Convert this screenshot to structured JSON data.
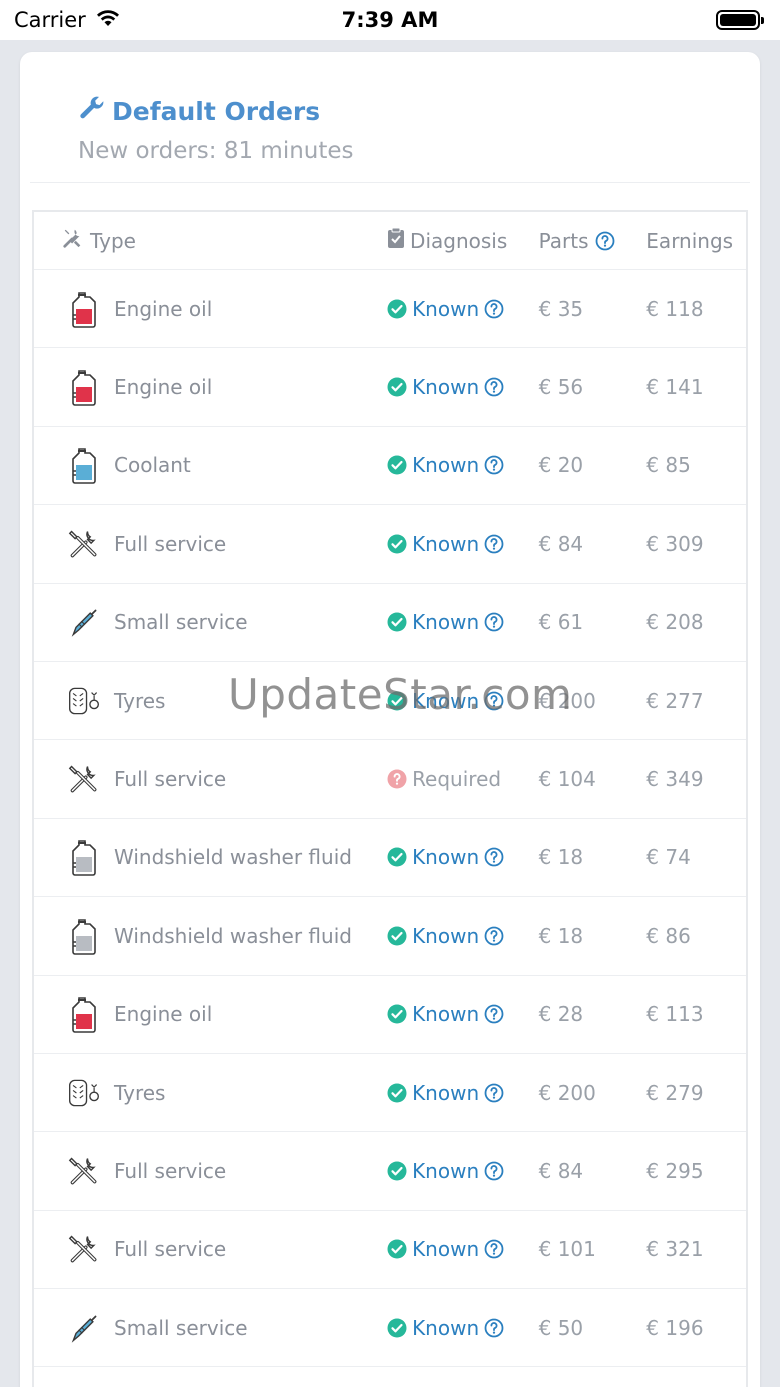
{
  "status_bar": {
    "carrier": "Carrier",
    "time": "7:39 AM"
  },
  "header": {
    "title": "Default Orders",
    "subtitle": "New orders: 81 minutes"
  },
  "table": {
    "columns": {
      "type": "Type",
      "diagnosis": "Diagnosis",
      "parts": "Parts",
      "earnings": "Earnings"
    },
    "rows": [
      {
        "icon": "engine-oil",
        "type": "Engine oil",
        "diagnosis": "Known",
        "status": "known",
        "parts": "€ 35",
        "earnings": "€ 118"
      },
      {
        "icon": "engine-oil",
        "type": "Engine oil",
        "diagnosis": "Known",
        "status": "known",
        "parts": "€ 56",
        "earnings": "€ 141"
      },
      {
        "icon": "coolant",
        "type": "Coolant",
        "diagnosis": "Known",
        "status": "known",
        "parts": "€ 20",
        "earnings": "€ 85"
      },
      {
        "icon": "full-service",
        "type": "Full service",
        "diagnosis": "Known",
        "status": "known",
        "parts": "€ 84",
        "earnings": "€ 309"
      },
      {
        "icon": "small-service",
        "type": "Small service",
        "diagnosis": "Known",
        "status": "known",
        "parts": "€ 61",
        "earnings": "€ 208"
      },
      {
        "icon": "tyres",
        "type": "Tyres",
        "diagnosis": "Known",
        "status": "known",
        "parts": "€ 200",
        "earnings": "€ 277"
      },
      {
        "icon": "full-service",
        "type": "Full service",
        "diagnosis": "Required",
        "status": "required",
        "parts": "€ 104",
        "earnings": "€ 349"
      },
      {
        "icon": "washer-fluid",
        "type": "Windshield washer fluid",
        "diagnosis": "Known",
        "status": "known",
        "parts": "€ 18",
        "earnings": "€ 74"
      },
      {
        "icon": "washer-fluid",
        "type": "Windshield washer fluid",
        "diagnosis": "Known",
        "status": "known",
        "parts": "€ 18",
        "earnings": "€ 86"
      },
      {
        "icon": "engine-oil",
        "type": "Engine oil",
        "diagnosis": "Known",
        "status": "known",
        "parts": "€ 28",
        "earnings": "€ 113"
      },
      {
        "icon": "tyres",
        "type": "Tyres",
        "diagnosis": "Known",
        "status": "known",
        "parts": "€ 200",
        "earnings": "€ 279"
      },
      {
        "icon": "full-service",
        "type": "Full service",
        "diagnosis": "Known",
        "status": "known",
        "parts": "€ 84",
        "earnings": "€ 295"
      },
      {
        "icon": "full-service",
        "type": "Full service",
        "diagnosis": "Known",
        "status": "known",
        "parts": "€ 101",
        "earnings": "€ 321"
      },
      {
        "icon": "small-service",
        "type": "Small service",
        "diagnosis": "Known",
        "status": "known",
        "parts": "€ 50",
        "earnings": "€ 196"
      }
    ]
  },
  "watermark": "UpdateStar.com",
  "colors": {
    "accent": "#4d8fcd",
    "known_check": "#26b89a",
    "required_badge": "#f0a3a8",
    "link": "#2a7fbf"
  }
}
